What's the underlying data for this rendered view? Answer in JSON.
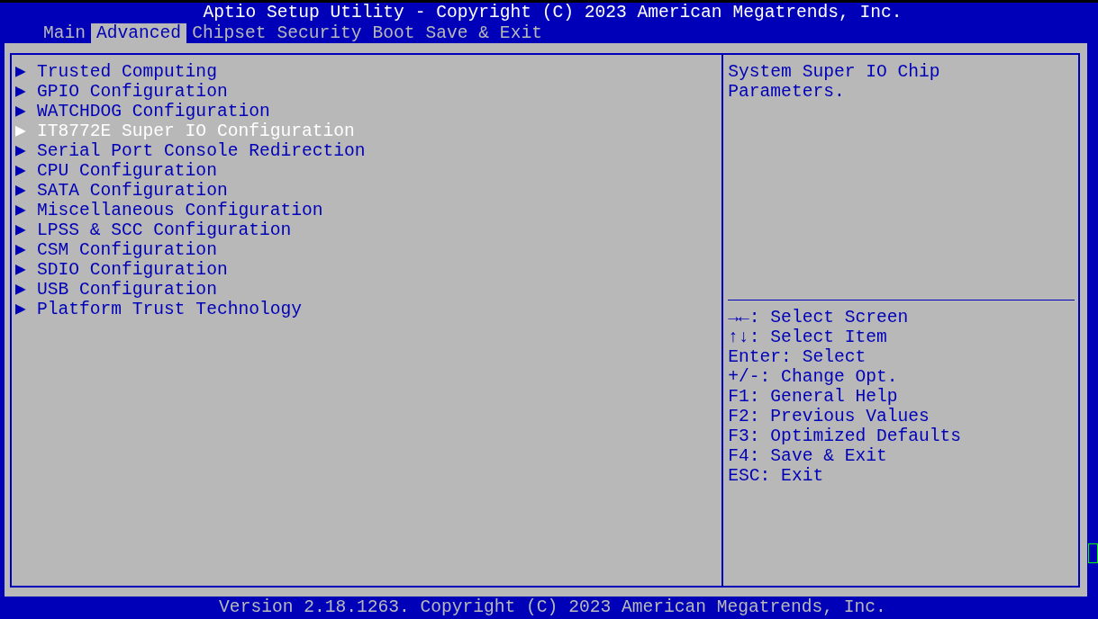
{
  "title": "Aptio Setup Utility - Copyright (C) 2023 American Megatrends, Inc.",
  "tabs": [
    {
      "label": "Main",
      "selected": false
    },
    {
      "label": "Advanced",
      "selected": true
    },
    {
      "label": "Chipset",
      "selected": false
    },
    {
      "label": "Security",
      "selected": false
    },
    {
      "label": "Boot",
      "selected": false
    },
    {
      "label": "Save & Exit",
      "selected": false
    }
  ],
  "menu": [
    {
      "arrow": "▶",
      "label": "Trusted Computing",
      "selected": false
    },
    {
      "arrow": "▶",
      "label": "GPIO Configuration",
      "selected": false
    },
    {
      "arrow": "▶",
      "label": "WATCHDOG Configuration",
      "selected": false
    },
    {
      "arrow": "▶",
      "label": "IT8772E Super IO Configuration",
      "selected": true
    },
    {
      "arrow": "▶",
      "label": "Serial Port Console Redirection",
      "selected": false
    },
    {
      "arrow": "▶",
      "label": "CPU Configuration",
      "selected": false
    },
    {
      "arrow": "▶",
      "label": "SATA Configuration",
      "selected": false
    },
    {
      "arrow": "▶",
      "label": "Miscellaneous Configuration",
      "selected": false
    },
    {
      "arrow": "▶",
      "label": "LPSS & SCC Configuration",
      "selected": false
    },
    {
      "arrow": "▶",
      "label": "CSM Configuration",
      "selected": false
    },
    {
      "arrow": "▶",
      "label": "SDIO Configuration",
      "selected": false
    },
    {
      "arrow": "▶",
      "label": "USB Configuration",
      "selected": false
    },
    {
      "arrow": "▶",
      "label": "Platform Trust Technology",
      "selected": false
    }
  ],
  "help_text": [
    "System Super IO Chip",
    "Parameters."
  ],
  "key_help": [
    "→←: Select Screen",
    "↑↓: Select Item",
    "Enter: Select",
    "+/-: Change Opt.",
    "F1: General Help",
    "F2: Previous Values",
    "F3: Optimized Defaults",
    "F4: Save & Exit",
    "ESC: Exit"
  ],
  "footer": "Version 2.18.1263. Copyright (C) 2023 American Megatrends, Inc."
}
